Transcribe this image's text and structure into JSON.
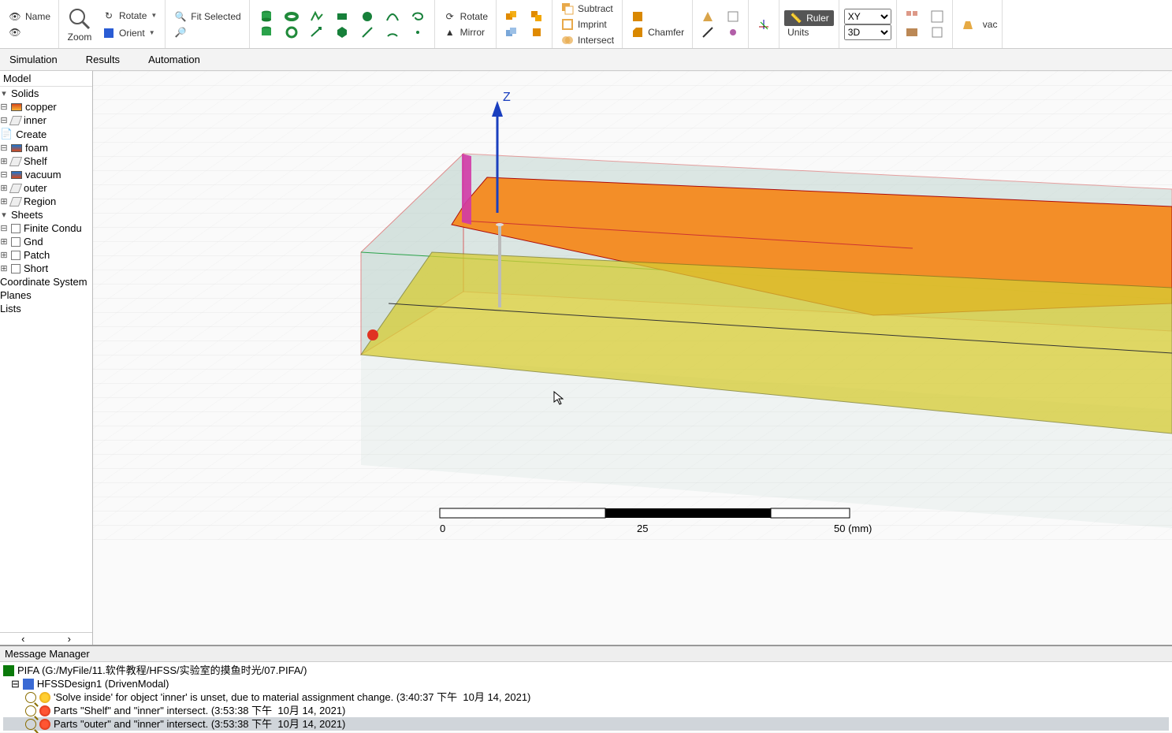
{
  "ribbon": {
    "name_label": "Name",
    "zoom_label": "Zoom",
    "rotate_label": "Rotate",
    "orient_label": "Orient",
    "fit_selected_label": "Fit Selected",
    "rotate2_label": "Rotate",
    "mirror_label": "Mirror",
    "subtract_label": "Subtract",
    "imprint_label": "Imprint",
    "intersect_label": "Intersect",
    "chamfer_label": "Chamfer",
    "ruler_label": "Ruler",
    "units_label": "Units",
    "plane_value": "XY",
    "view_value": "3D",
    "far_right_partial": "vac"
  },
  "menubar": {
    "sim": "Simulation",
    "results": "Results",
    "automation": "Automation"
  },
  "tree": {
    "header": "Model",
    "solids": "Solids",
    "copper": "copper",
    "inner": "inner",
    "create": "Create",
    "foam": "foam",
    "shelf": "Shelf",
    "vacuum": "vacuum",
    "outer": "outer",
    "region": "Region",
    "sheets": "Sheets",
    "finite": "Finite Condu",
    "gnd": "Gnd",
    "patch": "Patch",
    "short": "Short",
    "coord": "Coordinate System",
    "planes": "Planes",
    "lists": "Lists"
  },
  "viewport": {
    "axis_label": "Z",
    "scale": {
      "t0": "0",
      "t1": "25",
      "t2": "50 (mm)"
    }
  },
  "messages": {
    "title": "Message Manager",
    "project": "PIFA (G:/MyFile/11.软件教程/HFSS/实验室的摸鱼时光/07.PIFA/)",
    "design": "HFSSDesign1 (DrivenModal)",
    "m1": "'Solve inside' for object 'inner' is unset, due to material assignment change. (3:40:37 下午  10月 14, 2021)",
    "m2": "Parts \"Shelf\" and \"inner\" intersect. (3:53:38 下午  10月 14, 2021)",
    "m3": "Parts \"outer\" and \"inner\" intersect. (3:53:38 下午  10月 14, 2021)"
  }
}
